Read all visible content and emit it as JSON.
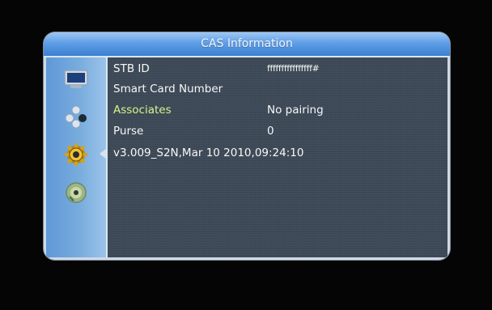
{
  "window": {
    "title": "CAS Information"
  },
  "sidebar": {
    "items": [
      {
        "icon": "tv-icon"
      },
      {
        "icon": "circles-icon"
      },
      {
        "icon": "gear-icon",
        "active": true
      },
      {
        "icon": "disc-icon"
      }
    ]
  },
  "info": {
    "rows": [
      {
        "label": "STB ID",
        "value": "ffffffffffffffff#"
      },
      {
        "label": "Smart Card Number",
        "value": ""
      },
      {
        "label": "Associates",
        "value": "No pairing"
      },
      {
        "label": "Purse",
        "value": "0"
      }
    ],
    "version": "v3.009_S2N,Mar 10 2010,09:24:10"
  },
  "colors": {
    "title_bar": "#5f9ee6",
    "sidebar": "#78acdd",
    "content_bg": "#3b4755",
    "highlight_text": "#d9f48b",
    "text": "#f7f7f7"
  }
}
